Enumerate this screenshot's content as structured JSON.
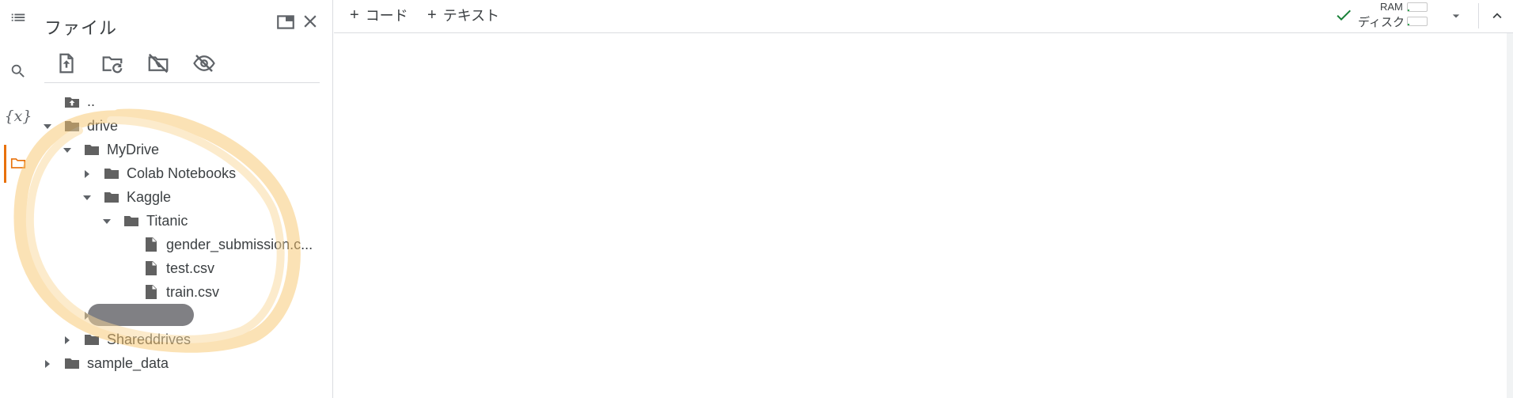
{
  "sidebar": {
    "panel_title": "ファイル",
    "active_section": "files",
    "rail_icons": [
      "toc-icon",
      "search-icon",
      "variables-icon",
      "folder-icon"
    ],
    "variables_glyph": "{x}",
    "toolbar_icons": [
      "upload-file-icon",
      "refresh-folder-icon",
      "mount-drive-icon",
      "hidden-files-icon"
    ],
    "tree": [
      {
        "label": "..",
        "kind": "parent",
        "depth": 0
      },
      {
        "label": "drive",
        "kind": "folder",
        "depth": 0,
        "expanded": true
      },
      {
        "label": "MyDrive",
        "kind": "folder",
        "depth": 1,
        "expanded": true
      },
      {
        "label": "Colab Notebooks",
        "kind": "folder",
        "depth": 2,
        "expanded": false
      },
      {
        "label": "Kaggle",
        "kind": "folder",
        "depth": 2,
        "expanded": true
      },
      {
        "label": "Titanic",
        "kind": "folder",
        "depth": 3,
        "expanded": true
      },
      {
        "label": "gender_submission.c...",
        "kind": "file",
        "depth": 4
      },
      {
        "label": "test.csv",
        "kind": "file",
        "depth": 4
      },
      {
        "label": "train.csv",
        "kind": "file",
        "depth": 4
      },
      {
        "label": "",
        "kind": "redacted",
        "depth": 2
      },
      {
        "label": "Shareddrives",
        "kind": "folder",
        "depth": 1,
        "expanded": false
      },
      {
        "label": "sample_data",
        "kind": "folder",
        "depth": 0,
        "expanded": false
      }
    ]
  },
  "toolbar": {
    "add_code_label": "コード",
    "add_text_label": "テキスト",
    "plus_glyph": "+"
  },
  "status": {
    "ram_label": "RAM",
    "disk_label": "ディスク",
    "ram_usage": 0.1,
    "disk_usage": 0.1
  },
  "colors": {
    "accent": "#e8710a",
    "check": "#188038",
    "highlight": "#f9c66e",
    "folder": "#616161"
  }
}
